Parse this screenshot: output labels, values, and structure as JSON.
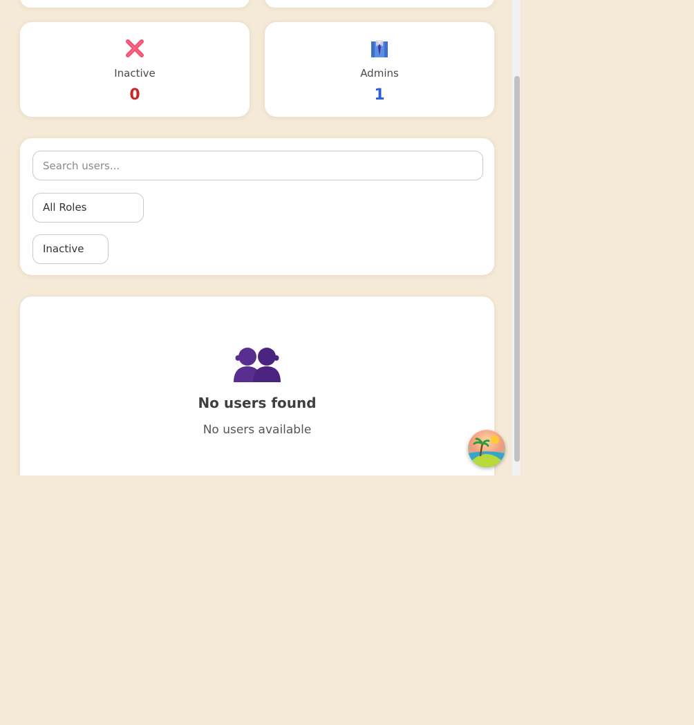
{
  "stats": [
    {
      "label": "Inactive",
      "value": "0",
      "icon": "cross-mark-icon",
      "color": "#c62828"
    },
    {
      "label": "Admins",
      "value": "1",
      "icon": "admin-suit-icon",
      "color": "#2a5fd8"
    }
  ],
  "filters": {
    "search_placeholder": "Search users...",
    "role_select": "All Roles",
    "status_select": "Inactive"
  },
  "empty_state": {
    "icon": "users-silhouette-icon",
    "title": "No users found",
    "subtitle": "No users available"
  },
  "fab": {
    "icon": "beach-island-icon"
  },
  "colors": {
    "background": "#f5ead7",
    "inactive_value": "#c62828",
    "admins_value": "#2a5fd8"
  }
}
